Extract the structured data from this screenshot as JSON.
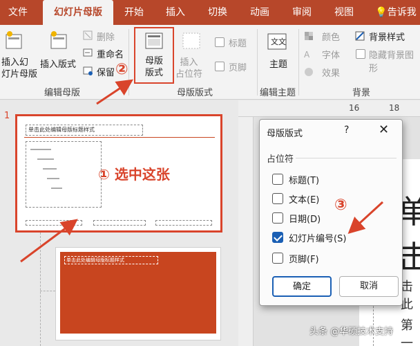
{
  "tabs": [
    "文件",
    "幻灯片母版",
    "开始",
    "插入",
    "切换",
    "动画",
    "审阅",
    "视图",
    "告诉我"
  ],
  "ribbon": {
    "insert_slide_master": [
      "插入幻",
      "灯片母版"
    ],
    "insert_layout": "插入版式",
    "delete": "删除",
    "rename": "重命名",
    "preserve": "保留",
    "master_layout": [
      "母版",
      "版式"
    ],
    "insert_placeholder": [
      "插入",
      "占位符"
    ],
    "title_check": "标题",
    "footer_check": "页脚",
    "theme": "主题",
    "colors": "颜色",
    "fonts": "字体",
    "effects": "效果",
    "background_styles": "背景样式",
    "hide_background": "隐藏背景图形",
    "group_edit_master": "编辑母版",
    "group_master_layout": "母版版式",
    "group_edit_theme": "编辑主题",
    "group_background": "背景"
  },
  "slides": {
    "slide1_number": "1",
    "slide1_title": "单击此处编辑母版标题样式",
    "slide2_title": "单击此处编辑母版标题样式"
  },
  "ruler": {
    "label16": "16",
    "label18": "18"
  },
  "canvas": {
    "big_char": "单击",
    "text2": "击此",
    "text3": "第一"
  },
  "dialog": {
    "title": "母版版式",
    "help": "?",
    "close": "✕",
    "section": "占位符",
    "options": [
      {
        "label": "标题(T)",
        "checked": false
      },
      {
        "label": "文本(E)",
        "checked": false
      },
      {
        "label": "日期(D)",
        "checked": false
      },
      {
        "label": "幻灯片编号(S)",
        "checked": true
      },
      {
        "label": "页脚(F)",
        "checked": false
      }
    ],
    "ok": "确定",
    "cancel": "取消"
  },
  "annotations": {
    "step1": "① 选中这张",
    "step2": "②",
    "step3": "③"
  },
  "watermark": "头条 @华硕技术支持",
  "colors": {
    "accent": "#b7472a",
    "annotation": "#d9442b",
    "slide_fill": "#c8451f",
    "checkbox": "#1a5fb4"
  }
}
